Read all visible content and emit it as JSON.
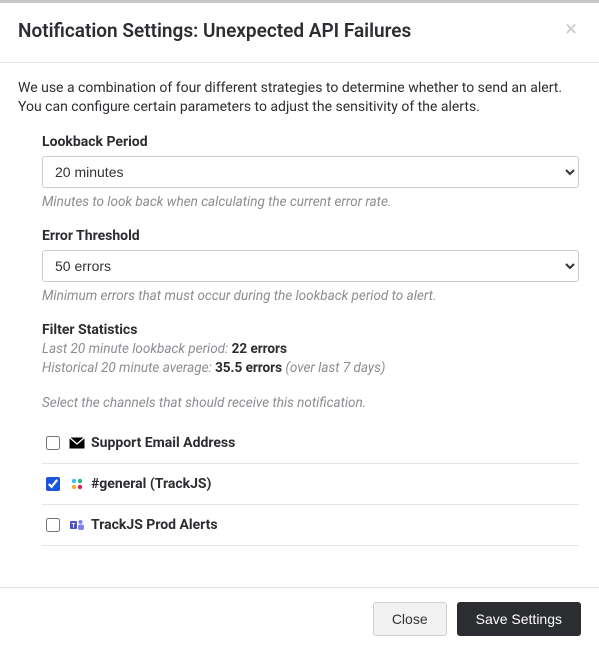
{
  "header": {
    "title": "Notification Settings: Unexpected API Failures"
  },
  "intro": "We use a combination of four different strategies to determine whether to send an alert. You can configure certain parameters to adjust the sensitivity of the alerts.",
  "lookback": {
    "label": "Lookback Period",
    "value": "20 minutes",
    "help": "Minutes to look back when calculating the current error rate."
  },
  "threshold": {
    "label": "Error Threshold",
    "value": "50 errors",
    "help": "Minimum errors that must occur during the lookback period to alert."
  },
  "stats": {
    "heading": "Filter Statistics",
    "recent_prefix": "Last 20 minute lookback period: ",
    "recent_value": "22 errors",
    "avg_prefix": "Historical 20 minute average: ",
    "avg_value": "35.5 errors",
    "avg_suffix": " (over last 7 days)"
  },
  "channels": {
    "hint": "Select the channels that should receive this notification.",
    "items": [
      {
        "label": "Support Email Address",
        "checked": false,
        "icon": "email"
      },
      {
        "label": "#general (TrackJS)",
        "checked": true,
        "icon": "slack"
      },
      {
        "label": "TrackJS Prod Alerts",
        "checked": false,
        "icon": "teams"
      }
    ]
  },
  "footer": {
    "close": "Close",
    "save": "Save Settings"
  }
}
